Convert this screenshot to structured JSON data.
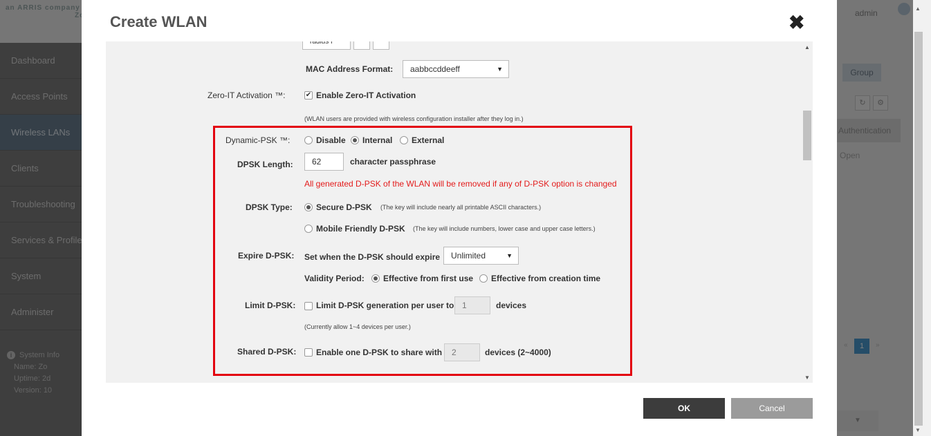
{
  "background": {
    "logo_text": "an ARRIS company",
    "logo_suffix": "Zo",
    "user": "admin",
    "sidebar": [
      {
        "label": "Dashboard",
        "active": false
      },
      {
        "label": "Access Points",
        "active": false
      },
      {
        "label": "Wireless LANs",
        "active": true
      },
      {
        "label": "Clients",
        "active": false
      },
      {
        "label": "Troubleshooting",
        "active": false
      },
      {
        "label": "Services & Profiles",
        "active": false
      },
      {
        "label": "System",
        "active": false
      },
      {
        "label": "Administer",
        "active": false
      }
    ],
    "system_info": {
      "title": "System Info",
      "name_label": "Name:",
      "name_value": "Zo",
      "uptime_label": "Uptime:",
      "uptime_value": "2d",
      "version_label": "Version:",
      "version_value": "10"
    },
    "group_tab": "Group",
    "auth_header": "Authentication",
    "auth_value": "Open",
    "pagination": {
      "current": "1",
      "prev": "«",
      "next": "»"
    },
    "refresh_icon": "refresh-icon",
    "settings_icon": "gear-icon"
  },
  "modal": {
    "title": "Create WLAN",
    "close": "✖",
    "partial_top": "radius f",
    "mac_format": {
      "label": "MAC Address Format:",
      "value": "aabbccddeeff"
    },
    "zero_it": {
      "label": "Zero-IT Activation ™:",
      "checkbox_label": "Enable Zero-IT Activation",
      "checked": true,
      "note": "(WLAN users are provided with wireless configuration installer after they log in.)"
    },
    "dynamic_psk": {
      "label": "Dynamic-PSK ™:",
      "options": [
        "Disable",
        "Internal",
        "External"
      ],
      "selected": "Internal"
    },
    "dpsk_length": {
      "label": "DPSK Length:",
      "value": "62",
      "suffix": "character passphrase"
    },
    "warning": "All generated D-PSK of the WLAN will be removed if any of D-PSK option is changed",
    "dpsk_type": {
      "label": "DPSK Type:",
      "secure": {
        "label": "Secure D-PSK",
        "note": "(The key will include nearly all printable ASCII characters.)",
        "selected": true
      },
      "mobile": {
        "label": "Mobile Friendly D-PSK",
        "note": "(The key will include numbers, lower case and upper case letters.)",
        "selected": false
      }
    },
    "expire": {
      "label": "Expire D-PSK:",
      "text": "Set when the D-PSK should expire",
      "value": "Unlimited",
      "validity_label": "Validity Period:",
      "validity_options": [
        "Effective from first use",
        "Effective from creation time"
      ],
      "validity_selected": "Effective from first use"
    },
    "limit": {
      "label": "Limit D-PSK:",
      "checkbox_label": "Limit D-PSK generation per user to",
      "value": "1",
      "suffix": "devices",
      "note": "(Currently allow 1~4 devices per user.)",
      "checked": false
    },
    "shared": {
      "label": "Shared D-PSK:",
      "checkbox_label": "Enable one D-PSK to share with",
      "value": "2",
      "suffix": "devices (2~4000)",
      "checked": false
    },
    "ok_label": "OK",
    "cancel_label": "Cancel"
  }
}
